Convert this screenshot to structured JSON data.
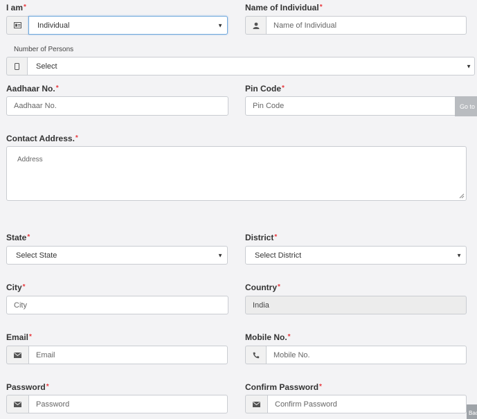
{
  "form": {
    "i_am": {
      "label": "I am",
      "value": "Individual"
    },
    "name": {
      "label": "Name of Individual",
      "placeholder": "Name of Individual"
    },
    "persons": {
      "label": "Number of Persons",
      "value": "Select"
    },
    "aadhaar": {
      "label": "Aadhaar No.",
      "placeholder": "Aadhaar No."
    },
    "pincode": {
      "label": "Pin Code",
      "placeholder": "Pin Code",
      "button": "Go to"
    },
    "address": {
      "label": "Contact Address.",
      "placeholder": "Address"
    },
    "state": {
      "label": "State",
      "value": "Select State"
    },
    "district": {
      "label": "District",
      "value": "Select District"
    },
    "city": {
      "label": "City",
      "placeholder": "City"
    },
    "country": {
      "label": "Country",
      "value": "India"
    },
    "email": {
      "label": "Email",
      "placeholder": "Email"
    },
    "mobile": {
      "label": "Mobile No.",
      "placeholder": "Mobile No."
    },
    "password": {
      "label": "Password",
      "placeholder": "Password"
    },
    "confirm_password": {
      "label": "Confirm Password",
      "placeholder": "Confirm Password"
    },
    "back_button": "Back"
  },
  "ui": {
    "required_mark": "*",
    "dropdown_glyph": "▼",
    "icons": {
      "i_am": "id-card-icon",
      "name": "user-icon",
      "persons": "mobile-device-icon",
      "email": "envelope-icon",
      "mobile": "phone-icon",
      "password": "envelope-icon",
      "confirm_password": "envelope-icon"
    },
    "colors": {
      "required": "#e8383d",
      "focus_border": "#6fa8dc",
      "button": "#b9bcc0"
    }
  }
}
